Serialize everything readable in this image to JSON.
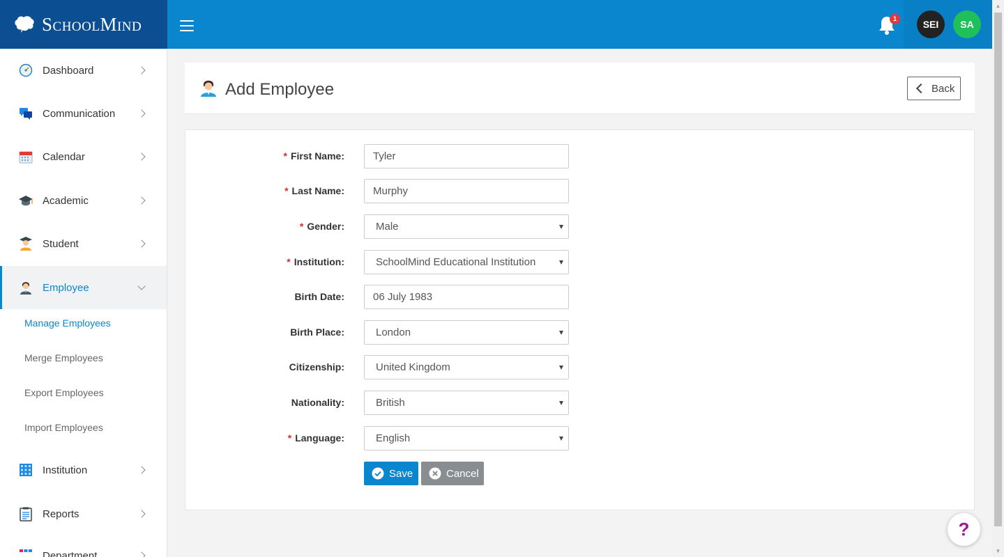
{
  "brand": {
    "name": "SchoolMind"
  },
  "topbar": {
    "notification_count": "1",
    "avatars": [
      {
        "initials": "SEI",
        "color": "#222222"
      },
      {
        "initials": "SA",
        "color": "#1fbf5a"
      }
    ]
  },
  "sidebar": {
    "items": [
      {
        "label": "Dashboard",
        "icon": "dashboard-icon"
      },
      {
        "label": "Communication",
        "icon": "chat-icon"
      },
      {
        "label": "Calendar",
        "icon": "calendar-icon"
      },
      {
        "label": "Academic",
        "icon": "graduation-cap-icon"
      },
      {
        "label": "Student",
        "icon": "student-icon"
      },
      {
        "label": "Employee",
        "icon": "employee-icon"
      },
      {
        "label": "Institution",
        "icon": "building-grid-icon"
      },
      {
        "label": "Reports",
        "icon": "clipboard-icon"
      },
      {
        "label": "Department",
        "icon": "org-chart-icon"
      }
    ],
    "employee_sub": [
      {
        "label": "Manage Employees"
      },
      {
        "label": "Merge Employees"
      },
      {
        "label": "Export Employees"
      },
      {
        "label": "Import Employees"
      }
    ]
  },
  "header": {
    "title": "Add Employee",
    "back_label": "Back"
  },
  "form": {
    "fields": [
      {
        "label": "First Name:",
        "required": true,
        "type": "input",
        "value": "Tyler"
      },
      {
        "label": "Last Name:",
        "required": true,
        "type": "input",
        "value": "Murphy"
      },
      {
        "label": "Gender:",
        "required": true,
        "type": "select",
        "value": "Male"
      },
      {
        "label": "Institution:",
        "required": true,
        "type": "select",
        "value": "SchoolMind Educational Institution"
      },
      {
        "label": "Birth Date:",
        "required": false,
        "type": "input",
        "value": "06 July 1983"
      },
      {
        "label": "Birth Place:",
        "required": false,
        "type": "select",
        "value": "London"
      },
      {
        "label": "Citizenship:",
        "required": false,
        "type": "select",
        "value": "United Kingdom"
      },
      {
        "label": "Nationality:",
        "required": false,
        "type": "select",
        "value": "British"
      },
      {
        "label": "Language:",
        "required": true,
        "type": "select",
        "value": "English"
      }
    ],
    "required_mark": "*",
    "save_label": "Save",
    "cancel_label": "Cancel"
  },
  "help": {
    "label": "?"
  },
  "colors": {
    "brand_dark": "#0b4e92",
    "topbar": "#0a86cf",
    "accent": "#0a86cf",
    "required": "#d32f2f"
  }
}
